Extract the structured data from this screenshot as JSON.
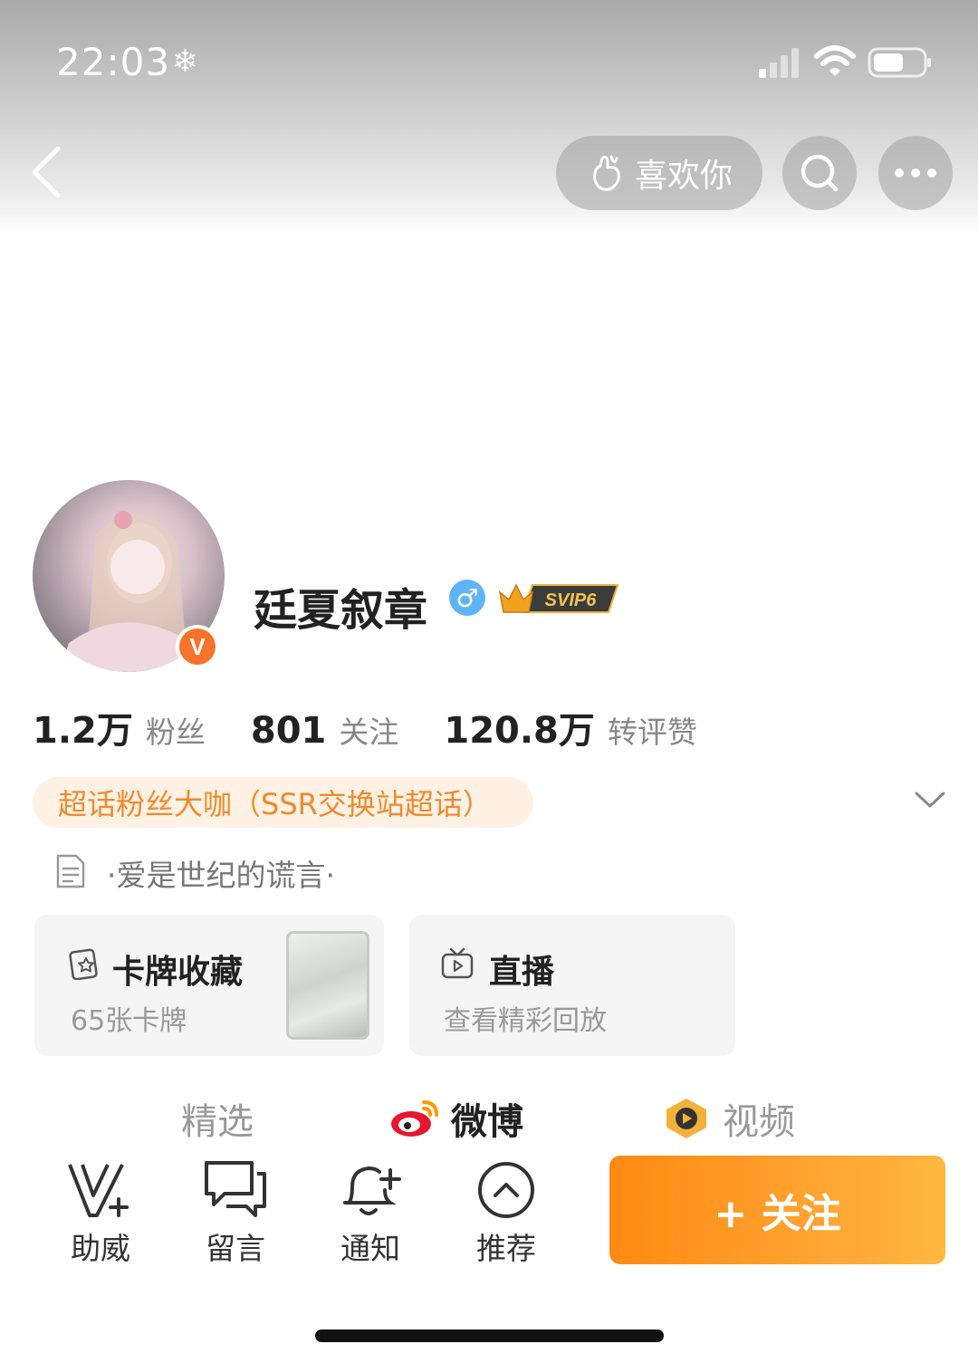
{
  "status_bar": {
    "time": "22:03"
  },
  "nav": {
    "like_label": "喜欢你"
  },
  "profile": {
    "name": "廷夏叙章",
    "vip_label": "SVIP6",
    "gender_symbol": "♂",
    "verified_mark": "V",
    "stats": [
      {
        "value": "1.2万",
        "label": "粉丝"
      },
      {
        "value": "801",
        "label": "关注"
      },
      {
        "value": "120.8万",
        "label": "转评赞"
      }
    ],
    "fan_tag": "超话粉丝大咖（SSR交换站超话）",
    "bio": "·爱是世纪的谎言·"
  },
  "cards": {
    "collection_title": "卡牌收藏",
    "collection_sub": "65张卡牌",
    "live_title": "直播",
    "live_sub": "查看精彩回放"
  },
  "tabs": [
    {
      "label": "精选"
    },
    {
      "label": "微博"
    },
    {
      "label": "视频"
    }
  ],
  "actions": [
    {
      "label": "助威"
    },
    {
      "label": "留言"
    },
    {
      "label": "通知"
    },
    {
      "label": "推荐"
    }
  ],
  "follow_label": "+ 关注",
  "colors": {
    "accent": "#ff8a12",
    "fan_tag_text": "#f08a2c",
    "verified": "#f5732a",
    "gender": "#5fb4f5"
  }
}
